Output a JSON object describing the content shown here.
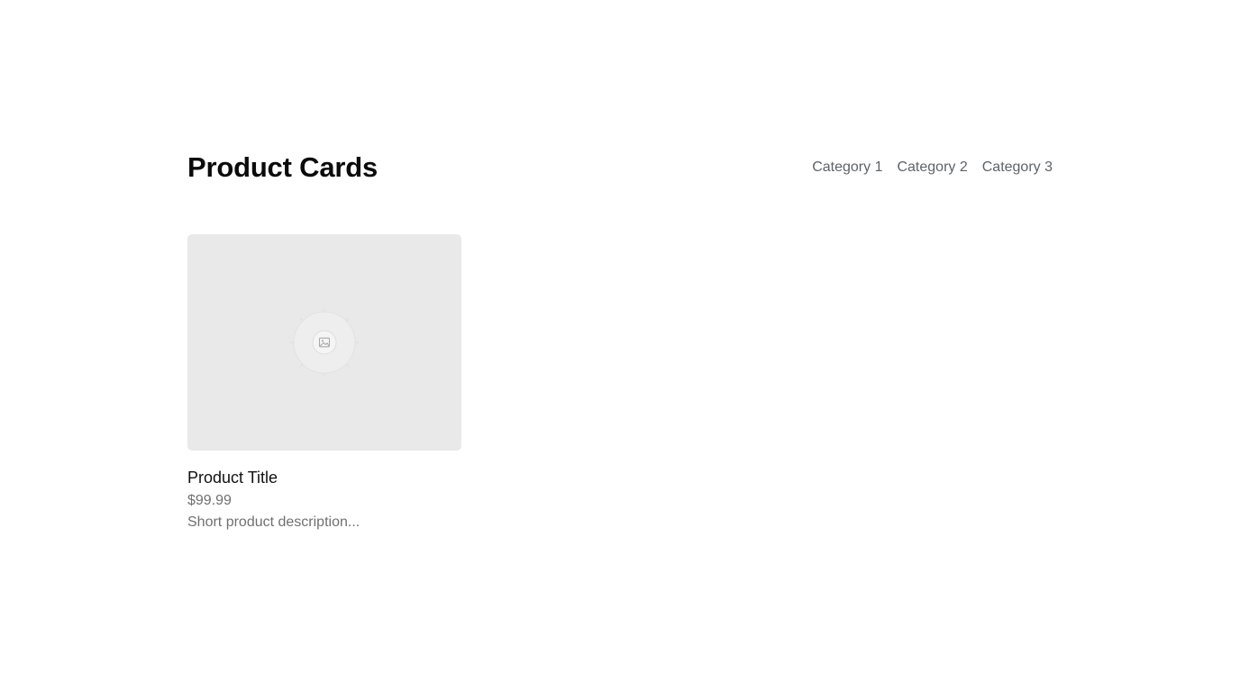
{
  "page": {
    "title": "Product Cards"
  },
  "nav": {
    "categories": [
      {
        "label": "Category 1"
      },
      {
        "label": "Category 2"
      },
      {
        "label": "Category 3"
      }
    ]
  },
  "products": [
    {
      "title": "Product Title",
      "price": "$99.99",
      "description": "Short product description...",
      "image_icon": "image-placeholder-icon"
    }
  ],
  "colors": {
    "background": "#ffffff",
    "title": "#0b0b0b",
    "nav_text": "#5f6368",
    "card_image_background": "#e9e9e9",
    "secondary_text": "#707070"
  }
}
